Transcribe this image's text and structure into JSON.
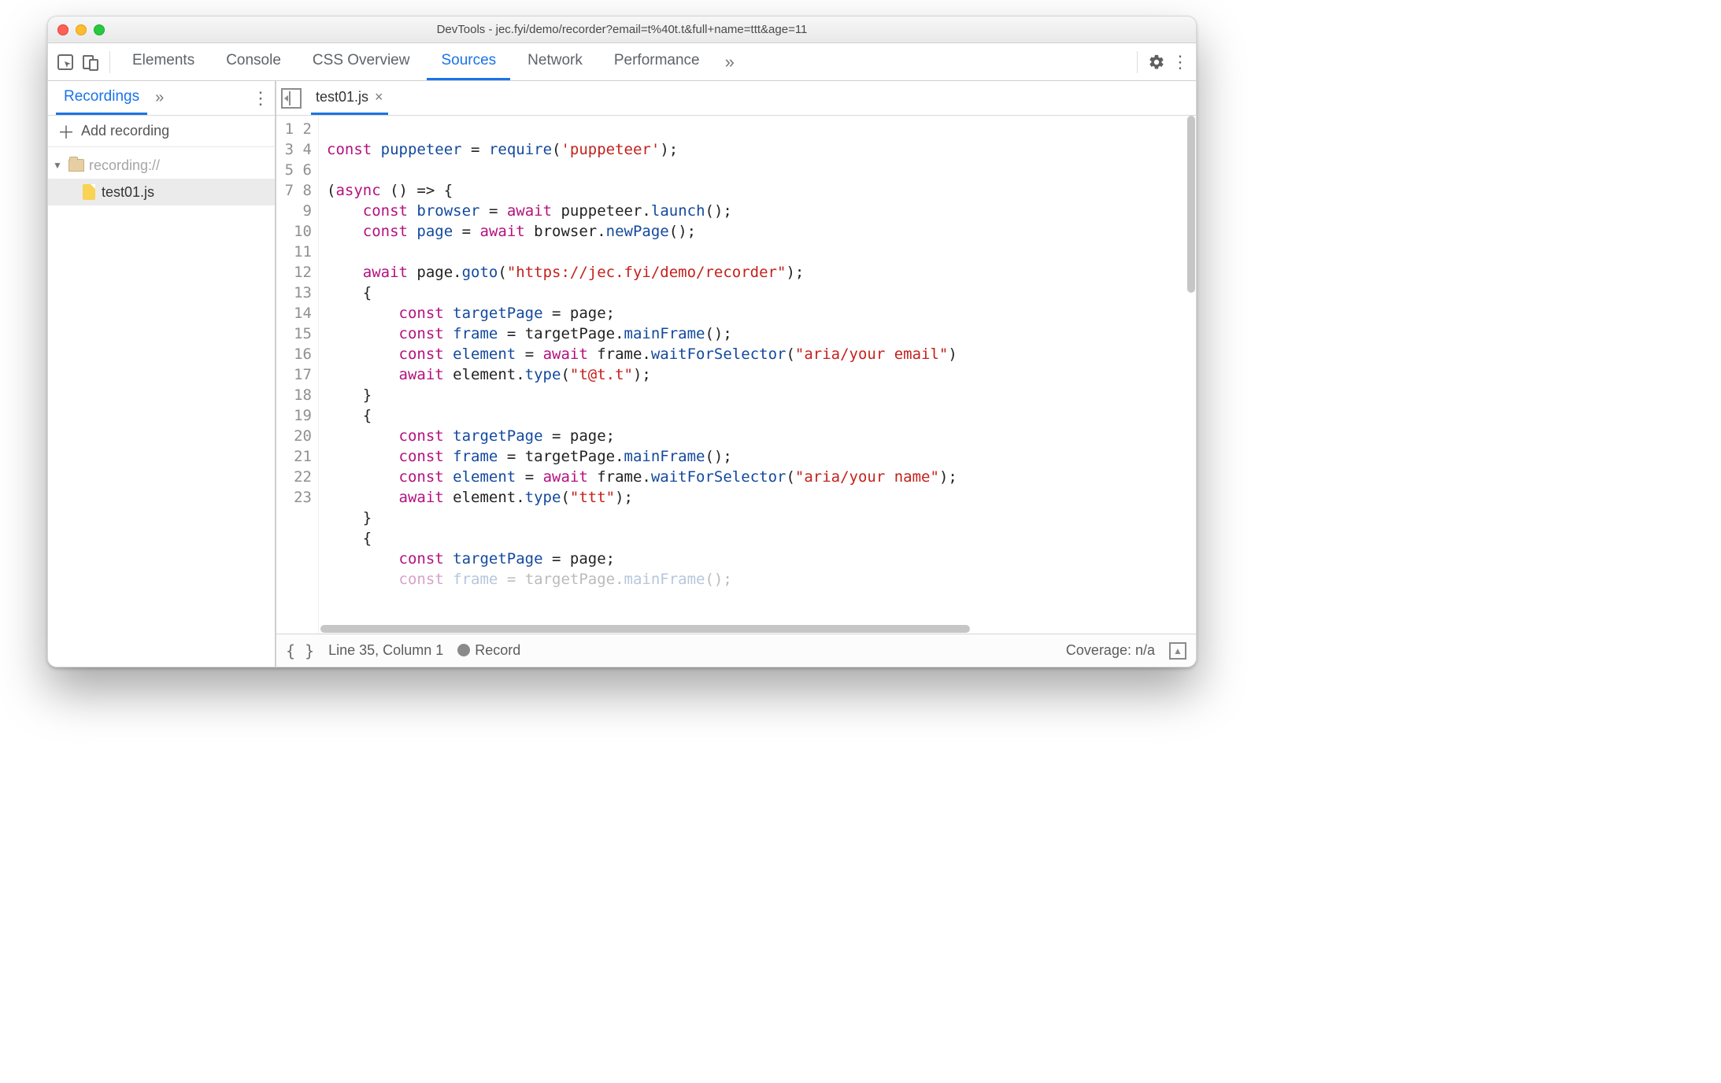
{
  "window": {
    "title": "DevTools - jec.fyi/demo/recorder?email=t%40t.t&full+name=ttt&age=11"
  },
  "mainTabs": {
    "items": [
      "Elements",
      "Console",
      "CSS Overview",
      "Sources",
      "Network",
      "Performance"
    ],
    "activeIndex": 3
  },
  "sidebar": {
    "tabLabel": "Recordings",
    "addLabel": "Add recording",
    "tree": {
      "rootLabel": "recording://",
      "fileLabel": "test01.js"
    }
  },
  "editor": {
    "openFile": "test01.js",
    "firstLineNumber": 1,
    "lastLineNumber": 23,
    "code": {
      "puppeteerRequire": "'puppeteer'",
      "gotoUrl": "\"https://jec.fyi/demo/recorder\"",
      "sel1": "\"aria/your email\"",
      "type1": "\"t@t.t\"",
      "sel2": "\"aria/your name\"",
      "type2": "\"ttt\""
    }
  },
  "status": {
    "lineCol": "Line 35, Column 1",
    "recordLabel": "Record",
    "coverage": "Coverage: n/a"
  }
}
